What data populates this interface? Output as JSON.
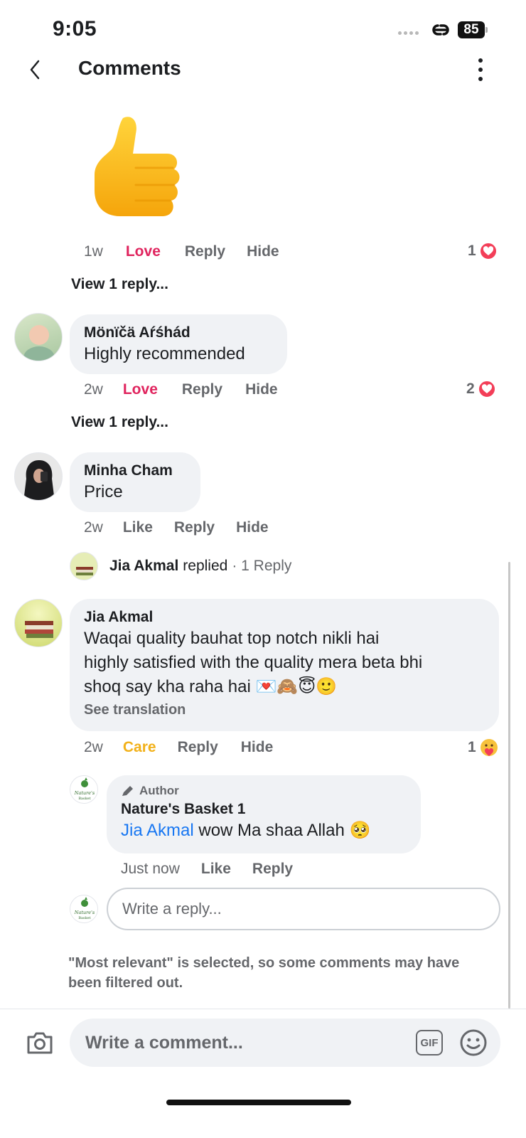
{
  "status_bar": {
    "time": "9:05",
    "battery": "85"
  },
  "header": {
    "title": "Comments"
  },
  "comments": [
    {
      "id": "thumb-comment",
      "time": "1w",
      "reaction_label": "Love",
      "reply": "Reply",
      "hide": "Hide",
      "reaction_count": "1",
      "view_replies": "View 1 reply..."
    },
    {
      "id": "monica",
      "author": "Mönïčä Aŕśhád",
      "text": "Highly recommended",
      "time": "2w",
      "reaction_label": "Love",
      "reply": "Reply",
      "hide": "Hide",
      "reaction_count": "2",
      "view_replies": "View 1 reply..."
    },
    {
      "id": "minha",
      "author": "Minha Cham",
      "text": "Price",
      "time": "2w",
      "reaction_label": "Like",
      "reply": "Reply",
      "hide": "Hide",
      "replied_summary": {
        "name": "Jia Akmal",
        "verb": "replied",
        "count": "· 1 Reply"
      }
    },
    {
      "id": "jia",
      "author": "Jia Akmal",
      "text_lines": [
        "Waqai quality bauhat top notch nikli hai",
        "highly satisfied with the quality mera beta bhi",
        "shoq say kha raha hai 💌🙈😇🙂"
      ],
      "see_translation": "See translation",
      "time": "2w",
      "reaction_label": "Care",
      "reply": "Reply",
      "hide": "Hide",
      "reaction_count": "1"
    }
  ],
  "author_reply": {
    "badge": "Author",
    "author": "Nature's Basket 1",
    "mention": "Jia Akmal",
    "text": " wow Ma shaa Allah 🥺",
    "time": "Just now",
    "like": "Like",
    "reply": "Reply"
  },
  "reply_input": {
    "placeholder": "Write a reply..."
  },
  "filter_note": "\"Most relevant\" is selected, so some comments may have been filtered out.",
  "composer": {
    "placeholder": "Write a comment...",
    "gif_label": "GIF"
  },
  "avatar_logo_text": "Nature's Basket",
  "colors": {
    "love": "#e0245e",
    "care": "#f2b11a",
    "mention": "#1877f2",
    "bubble": "#f0f2f5",
    "muted": "#65676b"
  }
}
